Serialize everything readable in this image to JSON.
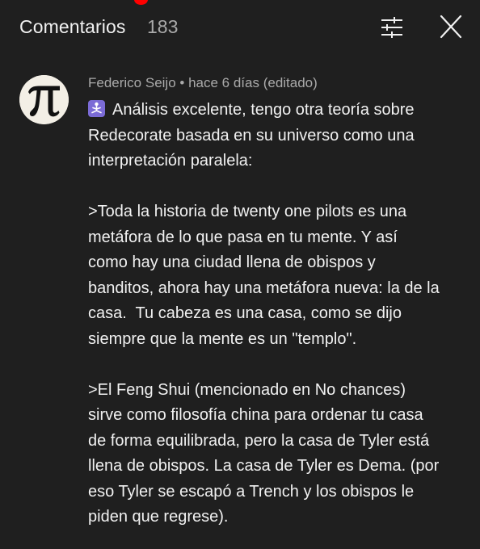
{
  "header": {
    "title": "Comentarios",
    "count": "183",
    "filter_icon": "sliders-icon",
    "close_icon": "close-icon"
  },
  "comment": {
    "author": "Federico Seijo",
    "separator": " • ",
    "time": "hace 6 días (editado)",
    "emoji": "person-in-lotus-position-emoji",
    "lines": [
      "Análisis excelente, tengo otra teoría sobre",
      "Redecorate basada en su universo como una",
      "interpretación paralela:",
      "",
      ">Toda la historia de twenty one pilots es una",
      "metáfora de lo que pasa en tu mente. Y así",
      "como hay una ciudad llena de obispos y",
      "banditos, ahora hay una metáfora nueva: la de la",
      "casa.  Tu cabeza es una casa, como se dijo",
      "siempre que la mente es un \"templo\".",
      "",
      ">El Feng Shui (mencionado en No chances)",
      "sirve como filosofía china para ordenar tu casa",
      "de forma equilibrada, pero la casa de Tyler está",
      "llena de obispos. La casa de Tyler es Dema. (por",
      "eso Tyler se escapó a Trench y los obispos le",
      "piden que regrese)."
    ]
  },
  "colors": {
    "background": "#1f1f1f",
    "text_primary": "#f1f1f1",
    "text_secondary": "#aaaaaa",
    "notification": "#ff0000",
    "emoji_badge": "#7b6bd6"
  }
}
